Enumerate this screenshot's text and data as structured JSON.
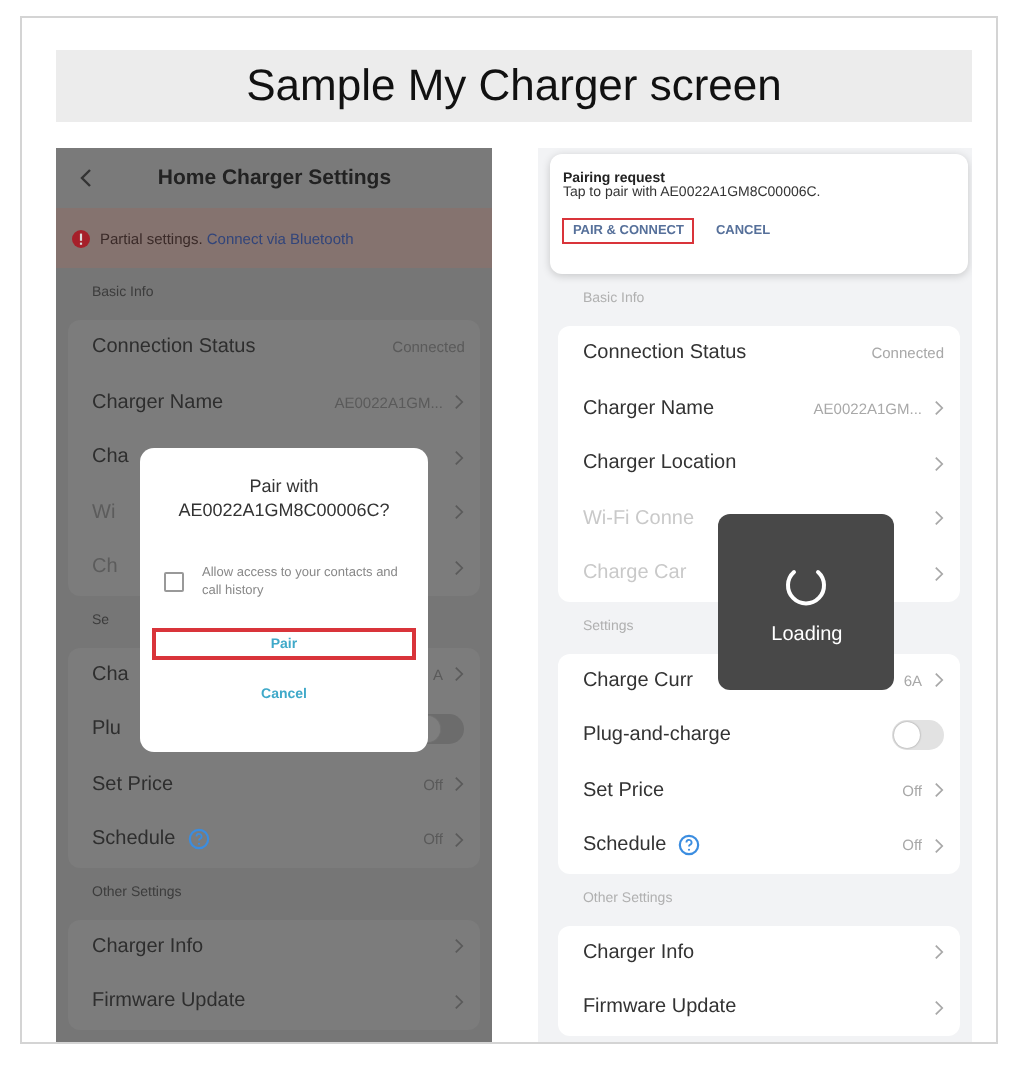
{
  "title": "Sample My Charger screen",
  "left_screen": {
    "header": {
      "title": "Home Charger Settings"
    },
    "banner": {
      "text": "Partial settings.",
      "link": "Connect via Bluetooth"
    },
    "sections": [
      {
        "heading": "Basic Info",
        "rows": [
          {
            "kind": "value",
            "label": "Connection Status",
            "value": "Connected",
            "chevron": false,
            "disabled": false
          },
          {
            "kind": "value",
            "label": "Charger Name",
            "value": "AE0022A1GM...",
            "chevron": true,
            "disabled": false
          },
          {
            "kind": "value",
            "label": "Cha",
            "chevron": true,
            "disabled": false
          },
          {
            "kind": "value",
            "label": "Wi",
            "chevron": true,
            "disabled": true
          },
          {
            "kind": "value",
            "label": "Ch",
            "chevron": true,
            "disabled": true
          }
        ]
      },
      {
        "heading": "Se",
        "rows": [
          {
            "kind": "value",
            "label": "Cha",
            "value": "A",
            "chevron": true,
            "disabled": false
          },
          {
            "kind": "toggle",
            "label": "Plu",
            "on": false,
            "disabled": false
          },
          {
            "kind": "value",
            "label": "Set Price",
            "value": "Off",
            "chevron": true,
            "disabled": false
          },
          {
            "kind": "help",
            "label": "Schedule",
            "value": "Off",
            "chevron": true,
            "disabled": false
          }
        ]
      },
      {
        "heading": "Other Settings",
        "rows": [
          {
            "kind": "value",
            "label": "Charger Info",
            "chevron": true,
            "disabled": false
          },
          {
            "kind": "value",
            "label": "Firmware Update",
            "chevron": true,
            "disabled": false
          }
        ]
      }
    ],
    "dialog": {
      "title": "Pair with AE0022A1GM8C00006C?",
      "checkbox": {
        "label": "Allow access to your contacts and call history",
        "checked": false
      },
      "buttons": [
        {
          "label": "Pair",
          "highlighted": true
        },
        {
          "label": "Cancel",
          "highlighted": false
        }
      ]
    }
  },
  "right_screen": {
    "notification": {
      "title": "Pairing request",
      "text": "Tap to pair with AE0022A1GM8C00006C.",
      "actions": [
        {
          "label": "PAIR & CONNECT",
          "highlighted": true
        },
        {
          "label": "CANCEL",
          "highlighted": false
        }
      ]
    },
    "sections": [
      {
        "heading": "Basic Info",
        "rows": [
          {
            "kind": "value",
            "label": "Connection Status",
            "value": "Connected",
            "chevron": false,
            "disabled": false
          },
          {
            "kind": "value",
            "label": "Charger Name",
            "value": "AE0022A1GM...",
            "chevron": true,
            "disabled": false
          },
          {
            "kind": "value",
            "label": "Charger Location",
            "chevron": true,
            "disabled": false
          },
          {
            "kind": "value",
            "label": "Wi-Fi Conne",
            "chevron": true,
            "disabled": true
          },
          {
            "kind": "value",
            "label": "Charge Car",
            "chevron": true,
            "disabled": true
          }
        ]
      },
      {
        "heading": "Settings",
        "rows": [
          {
            "kind": "value",
            "label": "Charge Curr",
            "value": "6A",
            "chevron": true,
            "disabled": false
          },
          {
            "kind": "toggle",
            "label": "Plug-and-charge",
            "on": false,
            "disabled": false
          },
          {
            "kind": "value",
            "label": "Set Price",
            "value": "Off",
            "chevron": true,
            "disabled": false
          },
          {
            "kind": "help",
            "label": "Schedule",
            "value": "Off",
            "chevron": true,
            "disabled": false
          }
        ]
      },
      {
        "heading": "Other Settings",
        "rows": [
          {
            "kind": "value",
            "label": "Charger Info",
            "chevron": true,
            "disabled": false
          },
          {
            "kind": "value",
            "label": "Firmware Update",
            "chevron": true,
            "disabled": false
          }
        ]
      }
    ],
    "toast": {
      "text": "Loading"
    }
  }
}
